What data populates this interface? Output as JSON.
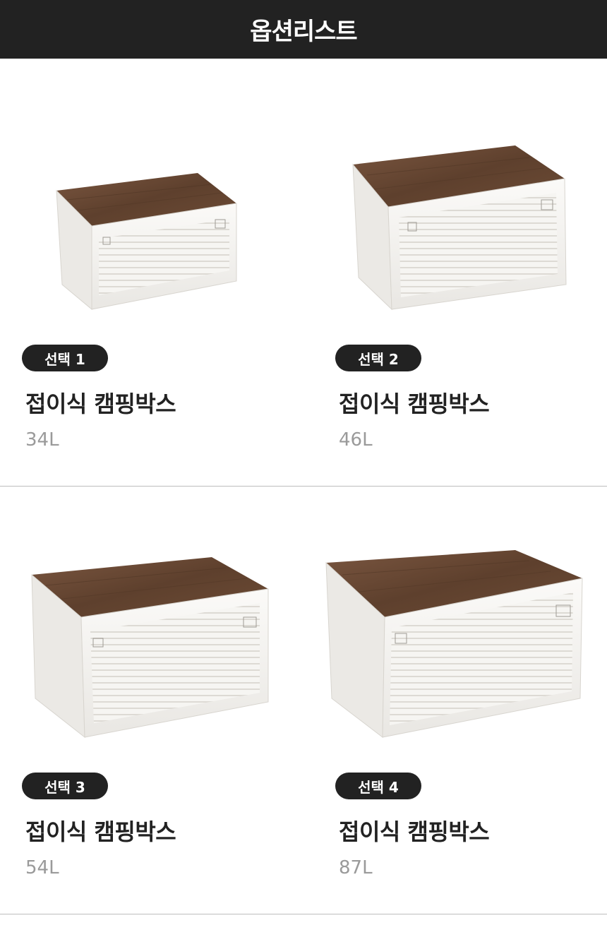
{
  "header": {
    "title": "옵션리스트"
  },
  "options": [
    {
      "badge": "선택 1",
      "name": "접이식 캠핑박스",
      "capacity": "34L"
    },
    {
      "badge": "선택 2",
      "name": "접이식 캠핑박스",
      "capacity": "46L"
    },
    {
      "badge": "선택 3",
      "name": "접이식 캠핑박스",
      "capacity": "54L"
    },
    {
      "badge": "선택 4",
      "name": "접이식 캠핑박스",
      "capacity": "87L"
    }
  ],
  "colors": {
    "header_bg": "#222222",
    "badge_bg": "#222222",
    "lid_wood": "#6b4a34",
    "box_body": "#f4f3f1",
    "capacity_text": "#9a9a9a"
  }
}
